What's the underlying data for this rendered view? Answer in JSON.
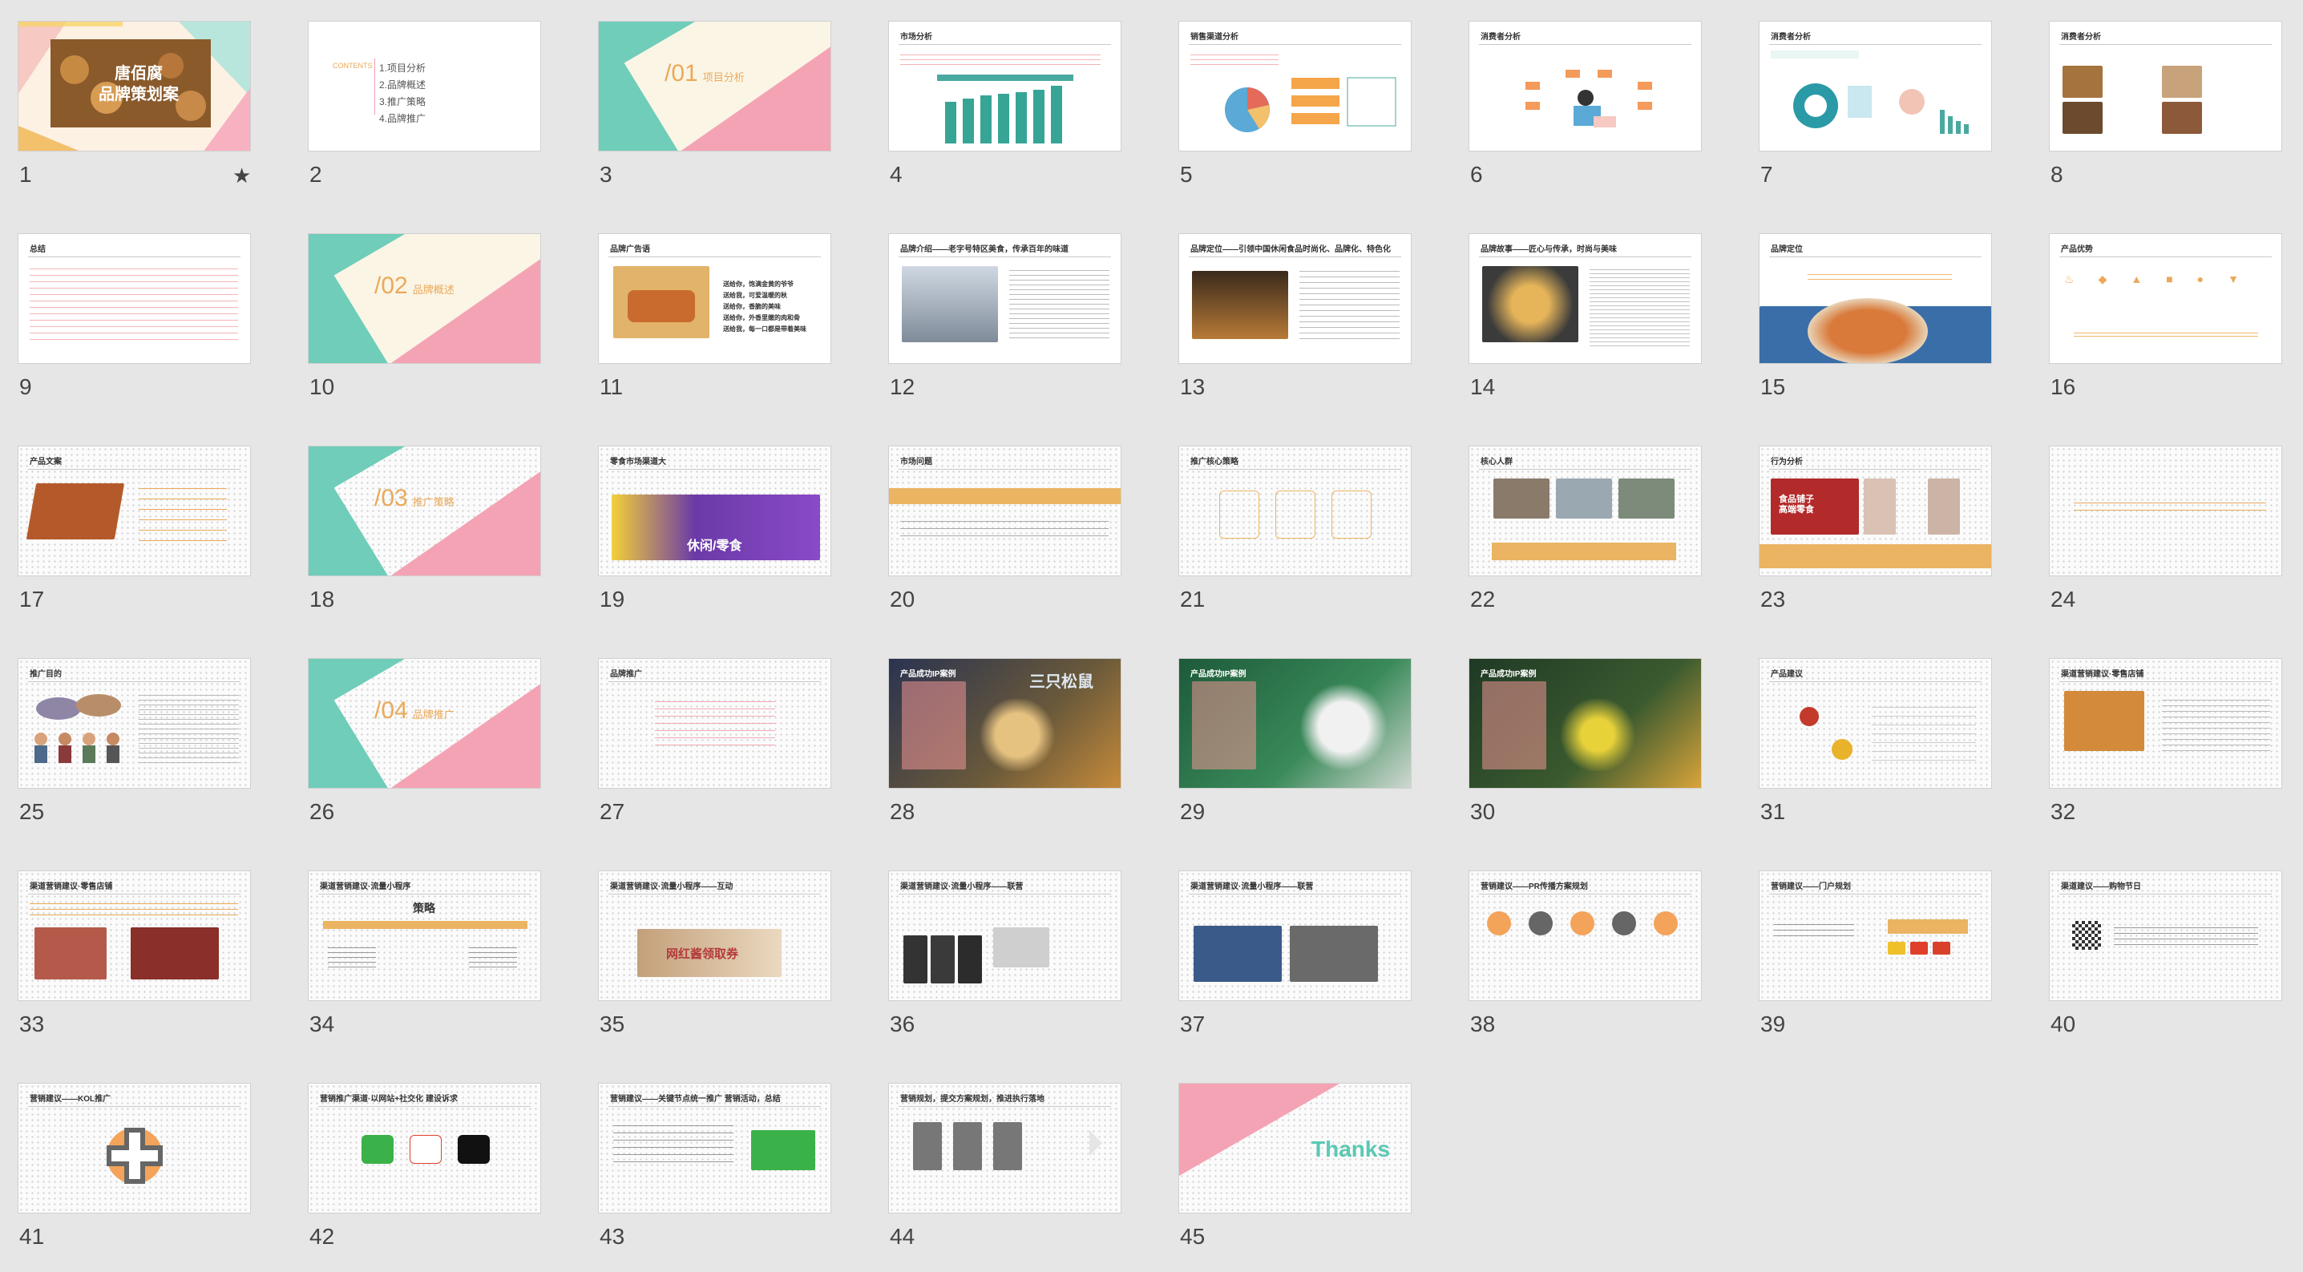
{
  "slides": [
    {
      "num": "1",
      "starred": true,
      "title": "唐佰腐\n品牌策划案"
    },
    {
      "num": "2",
      "contents_label": "CONTENTS",
      "items": [
        "1.项目分析",
        "2.品牌概述",
        "3.推广策略",
        "4.品牌推广"
      ]
    },
    {
      "num": "3",
      "section": "/01",
      "section_title": "项目分析"
    },
    {
      "num": "4",
      "title": "市场分析"
    },
    {
      "num": "5",
      "title": "销售渠道分析"
    },
    {
      "num": "6",
      "title": "消费者分析"
    },
    {
      "num": "7",
      "title": "消费者分析"
    },
    {
      "num": "8",
      "title": "消费者分析"
    },
    {
      "num": "9",
      "title": "总结"
    },
    {
      "num": "10",
      "section": "/02",
      "section_title": "品牌概述"
    },
    {
      "num": "11",
      "title": "品牌广告语",
      "lines": [
        "送给你，饱满金黄的爷爷",
        "送给我，可爱温暖的秋",
        "送给你，香脆的美味",
        "送给你，外香里嫩的肉和骨",
        "送给我，每一口都是带着美味"
      ]
    },
    {
      "num": "12",
      "title": "品牌介绍——老字号特区美食，传承百年的味道"
    },
    {
      "num": "13",
      "title": "品牌定位——引领中国休闲食品时尚化、品牌化、特色化"
    },
    {
      "num": "14",
      "title": "品牌故事——匠心与传承，时尚与美味"
    },
    {
      "num": "15",
      "title": "品牌定位"
    },
    {
      "num": "16",
      "title": "产品优势"
    },
    {
      "num": "17",
      "title": "产品文案"
    },
    {
      "num": "18",
      "section": "/03",
      "section_title": "推广策略"
    },
    {
      "num": "19",
      "title": "零食市场渠道大",
      "banner": "休闲/零食"
    },
    {
      "num": "20",
      "title": "市场问题"
    },
    {
      "num": "21",
      "title": "推广核心策略"
    },
    {
      "num": "22",
      "title": "核心人群"
    },
    {
      "num": "23",
      "title": "行为分析",
      "banner": "食品铺子\n高端零食"
    },
    {
      "num": "24",
      "title": ""
    },
    {
      "num": "25",
      "title": "推广目的"
    },
    {
      "num": "26",
      "section": "/04",
      "section_title": "品牌推广"
    },
    {
      "num": "27",
      "title": "品牌推广"
    },
    {
      "num": "28",
      "title": "产品成功IP案例",
      "brand": "三只松鼠"
    },
    {
      "num": "29",
      "title": "产品成功IP案例"
    },
    {
      "num": "30",
      "title": "产品成功IP案例"
    },
    {
      "num": "31",
      "title": "产品建议"
    },
    {
      "num": "32",
      "title": "渠道营销建议·零售店铺"
    },
    {
      "num": "33",
      "title": "渠道营销建议·零售店铺"
    },
    {
      "num": "34",
      "title": "渠道营销建议·流量小程序",
      "center_label": "策略"
    },
    {
      "num": "35",
      "title": "渠道营销建议·流量小程序——互动",
      "banner": "网红酱领取券"
    },
    {
      "num": "36",
      "title": "渠道营销建议·流量小程序——联营"
    },
    {
      "num": "37",
      "title": "渠道营销建议·流量小程序——联营"
    },
    {
      "num": "38",
      "title": "营销建议——PR传播方案规划"
    },
    {
      "num": "39",
      "title": "营销建议——门户规划"
    },
    {
      "num": "40",
      "title": "渠道建议——购物节日"
    },
    {
      "num": "41",
      "title": "营销建议——KOL推广"
    },
    {
      "num": "42",
      "title": "营销推广渠道·以网站+社交化 建设诉求"
    },
    {
      "num": "43",
      "title": "营销建议——关键节点统一推广 营销活动，总结"
    },
    {
      "num": "44",
      "title": "营销规划，提交方案规划，推进执行落地"
    },
    {
      "num": "45",
      "thanks": "Thanks"
    }
  ],
  "colors": {
    "pink": "#f29fb0",
    "teal": "#5bc8b4",
    "orange": "#eaa95a",
    "cream": "#fbf5e6",
    "tile_bg": "#e6e6e6"
  }
}
